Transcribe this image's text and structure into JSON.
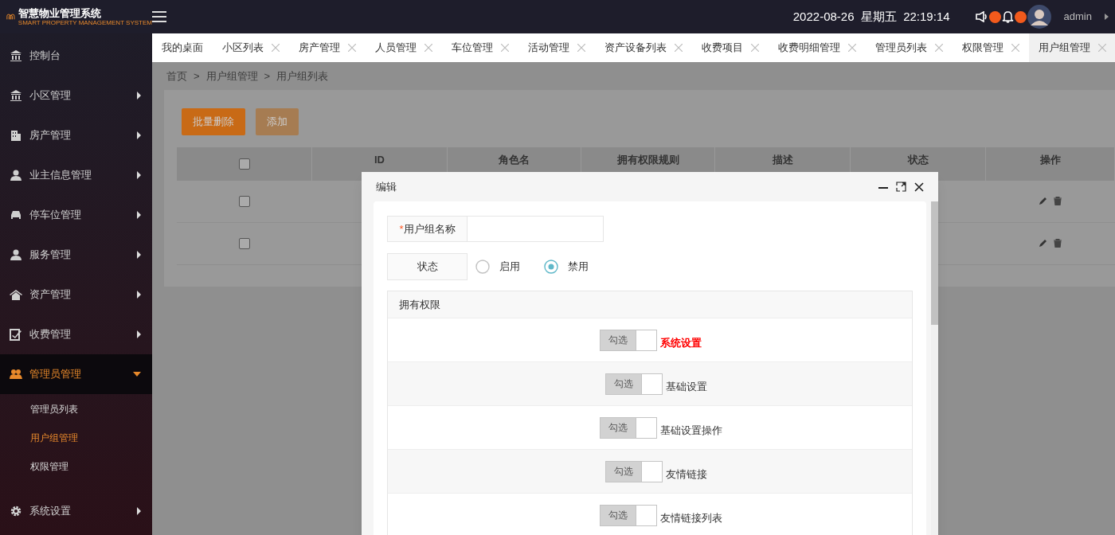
{
  "app": {
    "title": "智慧物业管理系统",
    "subtitle": "SMART PROPERTY MANAGEMENT SYSTEM"
  },
  "header": {
    "date": "2022-08-26",
    "weekday": "星期五",
    "time": "22:19:14",
    "user": "admin"
  },
  "sidebar": {
    "items": [
      {
        "label": "控制台",
        "expanded": false,
        "has_children": false
      },
      {
        "label": "小区管理",
        "expanded": false,
        "has_children": true
      },
      {
        "label": "房产管理",
        "expanded": false,
        "has_children": true
      },
      {
        "label": "业主信息管理",
        "expanded": false,
        "has_children": true
      },
      {
        "label": "停车位管理",
        "expanded": false,
        "has_children": true
      },
      {
        "label": "服务管理",
        "expanded": false,
        "has_children": true
      },
      {
        "label": "资产管理",
        "expanded": false,
        "has_children": true
      },
      {
        "label": "收费管理",
        "expanded": false,
        "has_children": true
      },
      {
        "label": "管理员管理",
        "expanded": true,
        "has_children": true,
        "children": [
          {
            "label": "管理员列表",
            "selected": false
          },
          {
            "label": "用户组管理",
            "selected": true
          },
          {
            "label": "权限管理",
            "selected": false
          }
        ]
      },
      {
        "label": "系统设置",
        "expanded": false,
        "has_children": true
      }
    ]
  },
  "tabs": [
    {
      "label": "我的桌面",
      "closable": false,
      "selected": false
    },
    {
      "label": "小区列表",
      "closable": true,
      "selected": false
    },
    {
      "label": "房产管理",
      "closable": true,
      "selected": false
    },
    {
      "label": "人员管理",
      "closable": true,
      "selected": false
    },
    {
      "label": "车位管理",
      "closable": true,
      "selected": false
    },
    {
      "label": "活动管理",
      "closable": true,
      "selected": false
    },
    {
      "label": "资产设备列表",
      "closable": true,
      "selected": false
    },
    {
      "label": "收费项目",
      "closable": true,
      "selected": false
    },
    {
      "label": "收费明细管理",
      "closable": true,
      "selected": false
    },
    {
      "label": "管理员列表",
      "closable": true,
      "selected": false
    },
    {
      "label": "权限管理",
      "closable": true,
      "selected": false
    },
    {
      "label": "用户组管理",
      "closable": true,
      "selected": true
    }
  ],
  "breadcrumb": {
    "items": [
      "首页",
      "用户组管理",
      "用户组列表"
    ],
    "separators": [
      ">",
      ">"
    ]
  },
  "toolbar": {
    "buttons": [
      "批量删除",
      "添加"
    ]
  },
  "table": {
    "header_checked": false,
    "columns": [
      "ID",
      "角色名",
      "拥有权限规则",
      "描述",
      "状态",
      "操作"
    ],
    "rows": [
      {
        "checked": false
      },
      {
        "checked": false
      }
    ]
  },
  "dialog": {
    "title": "编辑",
    "required_mark": "*",
    "name_label": "用户组名称",
    "status_label": "状态",
    "status_options": [
      {
        "label": "启用",
        "selected": false
      },
      {
        "label": "禁用",
        "selected": true
      }
    ],
    "permissions_label": "拥有权限",
    "permissions": [
      {
        "label": "系统设置",
        "check_label": "勾选",
        "checked": false,
        "children": [
          {
            "label": "基础设置",
            "check_label": "勾选",
            "checked": false,
            "children": [
              {
                "label": "基础设置操作",
                "check_label": "勾选",
                "checked": false
              }
            ]
          },
          {
            "label": "友情链接",
            "check_label": "勾选",
            "checked": false,
            "children": [
              {
                "label": "友情链接列表",
                "check_label": "勾选",
                "checked": false
              }
            ]
          }
        ]
      }
    ]
  }
}
